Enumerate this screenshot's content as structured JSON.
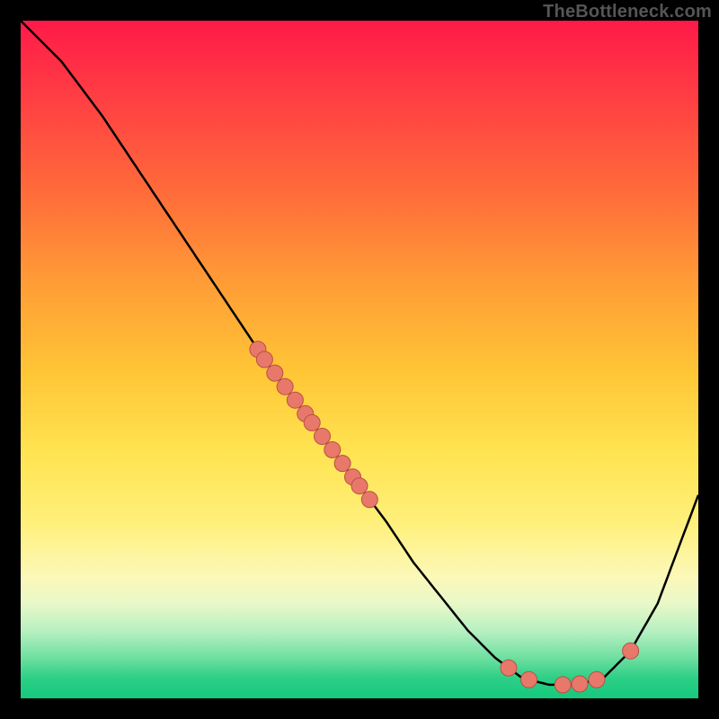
{
  "watermark": "TheBottleneck.com",
  "chart_data": {
    "type": "line",
    "title": "",
    "xlabel": "",
    "ylabel": "",
    "xlim": [
      0,
      100
    ],
    "ylim": [
      0,
      100
    ],
    "grid": false,
    "series": [
      {
        "name": "curve",
        "x": [
          0,
          6,
          12,
          18,
          24,
          30,
          36,
          42,
          48,
          54,
          58,
          62,
          66,
          70,
          74,
          78,
          82,
          86,
          90,
          94,
          100
        ],
        "values": [
          100,
          94,
          86,
          77,
          68,
          59,
          50,
          42,
          34,
          26,
          20,
          15,
          10,
          6,
          3,
          2,
          2,
          3,
          7,
          14,
          30
        ]
      }
    ],
    "points_on_curve": [
      {
        "name": "cluster-upper",
        "x": [
          35,
          36,
          37.5,
          39,
          40.5,
          42,
          43,
          44.5,
          46,
          47.5,
          49,
          50,
          51.5
        ]
      },
      {
        "name": "cluster-valley",
        "x": [
          72,
          75,
          80,
          82.5,
          85
        ]
      },
      {
        "name": "point-rising",
        "x": [
          90
        ]
      }
    ],
    "colors": {
      "line": "#000000",
      "point_fill": "#e8796a",
      "point_stroke": "#b84f44"
    }
  }
}
